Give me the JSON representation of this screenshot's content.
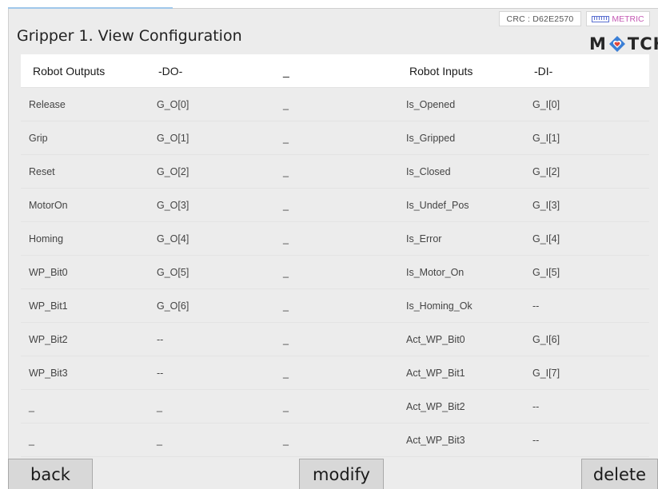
{
  "title": "Gripper 1. View Configuration",
  "crc_label": "CRC : D62E2570",
  "metric_label": "METRIC",
  "logo": {
    "left": "M",
    "right": "TCH"
  },
  "headers": [
    "Robot Outputs",
    "-DO-",
    "_",
    "Robot Inputs",
    "-DI-"
  ],
  "rows": [
    [
      "Release",
      "G_O[0]",
      "_",
      "Is_Opened",
      "G_I[0]"
    ],
    [
      "Grip",
      "G_O[1]",
      "_",
      "Is_Gripped",
      "G_I[1]"
    ],
    [
      "Reset",
      "G_O[2]",
      "_",
      "Is_Closed",
      "G_I[2]"
    ],
    [
      "MotorOn",
      "G_O[3]",
      "_",
      "Is_Undef_Pos",
      "G_I[3]"
    ],
    [
      "Homing",
      "G_O[4]",
      "_",
      "Is_Error",
      "G_I[4]"
    ],
    [
      "WP_Bit0",
      "G_O[5]",
      "_",
      "Is_Motor_On",
      "G_I[5]"
    ],
    [
      "WP_Bit1",
      "G_O[6]",
      "_",
      "Is_Homing_Ok",
      "--"
    ],
    [
      "WP_Bit2",
      "--",
      "_",
      "Act_WP_Bit0",
      "G_I[6]"
    ],
    [
      "WP_Bit3",
      "--",
      "_",
      "Act_WP_Bit1",
      "G_I[7]"
    ],
    [
      "_",
      "_",
      "_",
      "Act_WP_Bit2",
      "--"
    ],
    [
      "_",
      "_",
      "_",
      "Act_WP_Bit3",
      "--"
    ]
  ],
  "buttons": {
    "back": "back",
    "modify": "modify",
    "delete": "delete"
  },
  "icons": {
    "crc": "none",
    "metric": "ruler-icon",
    "logo": "heart-diamond-icon"
  },
  "colors": {
    "panel": "#ececec",
    "metric": "#c45ab4",
    "ruler": "#5a6fd0",
    "accent": "#9fc7ea"
  }
}
